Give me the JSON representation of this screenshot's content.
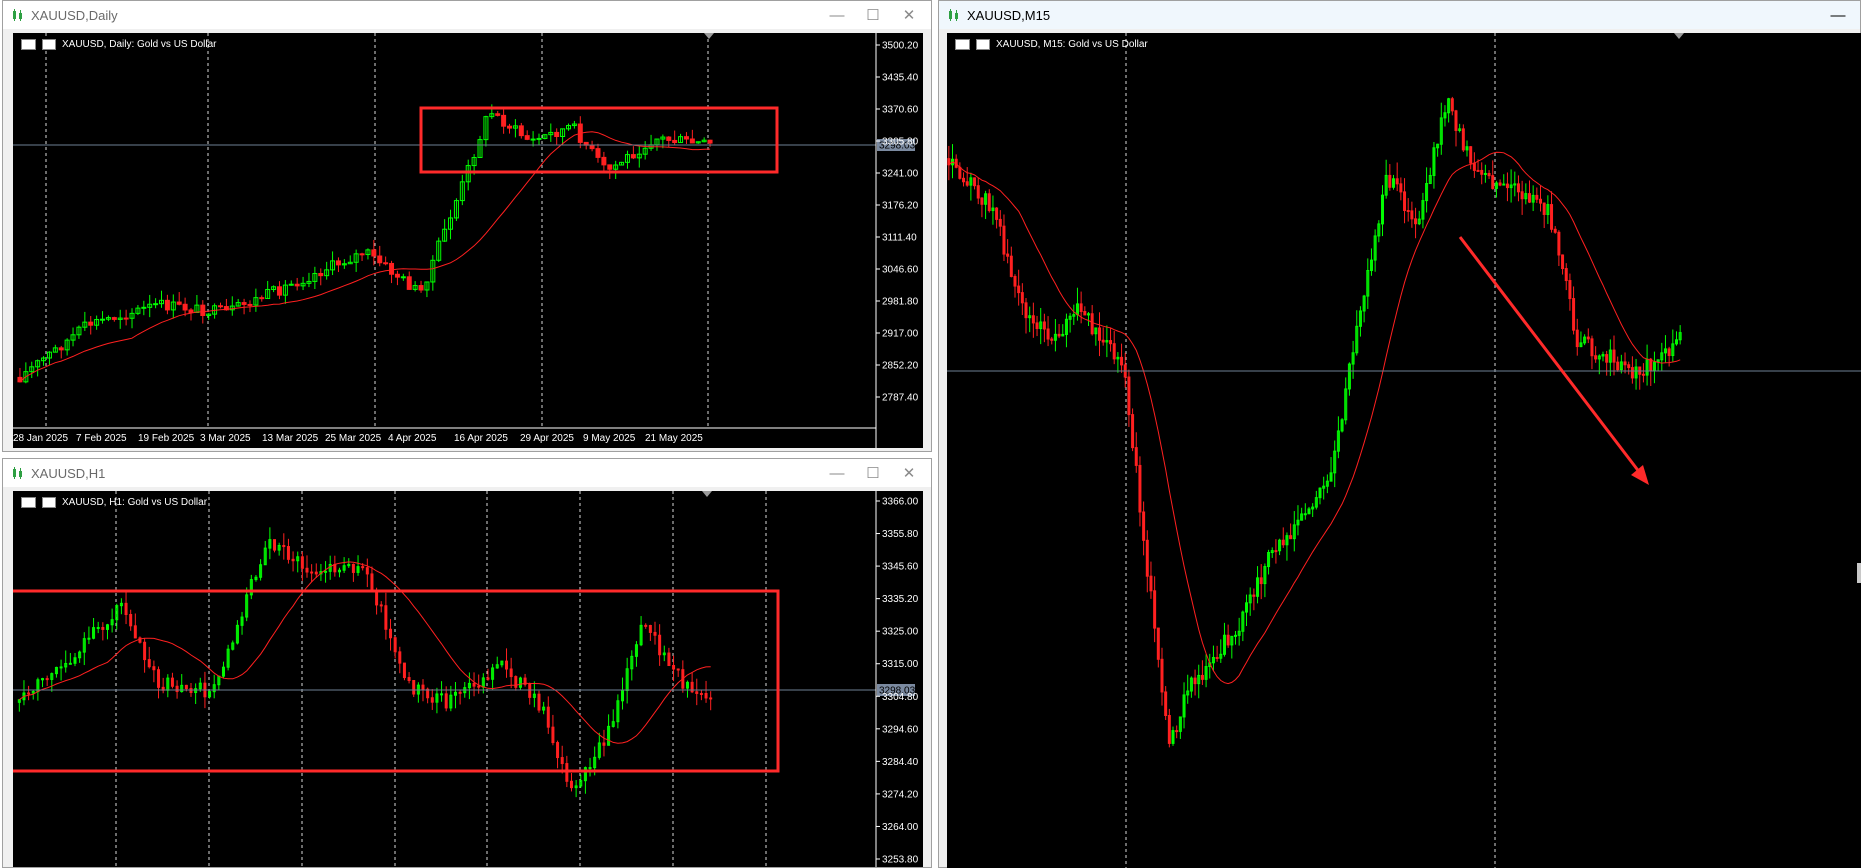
{
  "daily": {
    "window_title": "XAUUSD,Daily",
    "symbol_label": "XAUUSD, Daily:  Gold vs US Dollar",
    "current_price": "3298.03",
    "price_axis": [
      "3500.20",
      "3435.40",
      "3370.60",
      "3305.80",
      "3241.00",
      "3176.20",
      "3111.40",
      "3046.60",
      "2981.80",
      "2917.00",
      "2852.20",
      "2787.40"
    ],
    "date_axis": [
      "28 Jan 2025",
      "7 Feb 2025",
      "19 Feb 2025",
      "3 Mar 2025",
      "13 Mar 2025",
      "25 Mar 2025",
      "4 Apr 2025",
      "16 Apr 2025",
      "29 Apr 2025",
      "9 May 2025",
      "21 May 2025"
    ]
  },
  "h1": {
    "window_title": "XAUUSD,H1",
    "symbol_label": "XAUUSD, H1:  Gold vs US Dollar",
    "current_price": "3298.03",
    "price_axis": [
      "3366.00",
      "3355.80",
      "3345.60",
      "3335.20",
      "3325.00",
      "3315.00",
      "3304.80",
      "3294.60",
      "3284.40",
      "3274.20",
      "3264.00",
      "3253.80"
    ]
  },
  "m15": {
    "window_title": "XAUUSD,M15",
    "symbol_label": "XAUUSD, M15:  Gold vs US Dollar"
  },
  "window_buttons": {
    "minimize": "—",
    "maximize": "☐",
    "close": "✕"
  },
  "colors": {
    "bull": "#00ff00",
    "bear": "#ff2020",
    "ma": "#ff2020",
    "annotation": "#ff2a2a",
    "grid": "#ffffff",
    "current_line": "#6e7f93"
  }
}
